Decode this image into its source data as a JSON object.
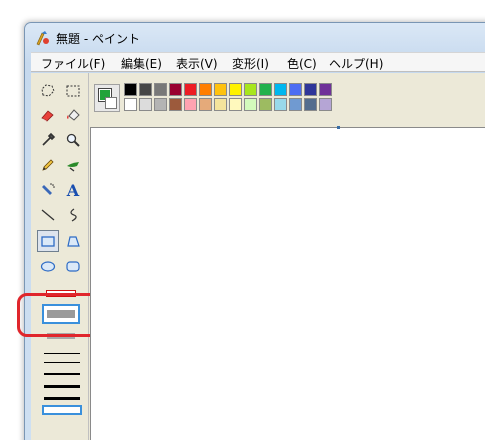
{
  "window": {
    "title": "無題 - ペイント"
  },
  "menu": [
    {
      "label": "ファイル(F)"
    },
    {
      "label": "編集(E)"
    },
    {
      "label": "表示(V)"
    },
    {
      "label": "変形(I)"
    },
    {
      "label": "色(C)"
    },
    {
      "label": "ヘルプ(H)"
    }
  ],
  "tools": [
    {
      "name": "free-select",
      "icon": "free-form-select-icon"
    },
    {
      "name": "rect-select",
      "icon": "rect-select-icon"
    },
    {
      "name": "eraser",
      "icon": "eraser-icon"
    },
    {
      "name": "fill",
      "icon": "fill-bucket-icon"
    },
    {
      "name": "color-picker",
      "icon": "eyedropper-icon"
    },
    {
      "name": "magnifier",
      "icon": "magnifier-icon"
    },
    {
      "name": "pencil",
      "icon": "pencil-icon"
    },
    {
      "name": "brush",
      "icon": "brush-icon"
    },
    {
      "name": "airbrush",
      "icon": "airbrush-icon"
    },
    {
      "name": "text",
      "icon": "text-icon",
      "glyph": "A"
    },
    {
      "name": "line",
      "icon": "line-icon"
    },
    {
      "name": "curve",
      "icon": "curve-icon"
    },
    {
      "name": "rectangle",
      "icon": "rectangle-icon",
      "selected": true
    },
    {
      "name": "polygon",
      "icon": "polygon-icon"
    },
    {
      "name": "ellipse",
      "icon": "ellipse-icon"
    },
    {
      "name": "rounded-rectangle",
      "icon": "rounded-rectangle-icon"
    }
  ],
  "colors": {
    "foreground": "#22a33a",
    "background": "#ffffff",
    "palette_row1": [
      "#000000",
      "#464646",
      "#787878",
      "#990030",
      "#ed1c24",
      "#ff7e00",
      "#ffc20e",
      "#fff200",
      "#a8e61d",
      "#22b14c",
      "#00b7ef",
      "#4d6df3",
      "#2f3699",
      "#6f3198"
    ],
    "palette_row2": [
      "#ffffff",
      "#dcdcdc",
      "#b4b4b4",
      "#9c5a3c",
      "#ffa3b1",
      "#e5aa7a",
      "#f5e49c",
      "#fff9bd",
      "#d3f9bc",
      "#9dbb61",
      "#99d9ea",
      "#709ad1",
      "#546d8e",
      "#b5a5d5"
    ],
    "highlight": "#e0262c",
    "selection_blue": "#3a90dc"
  }
}
